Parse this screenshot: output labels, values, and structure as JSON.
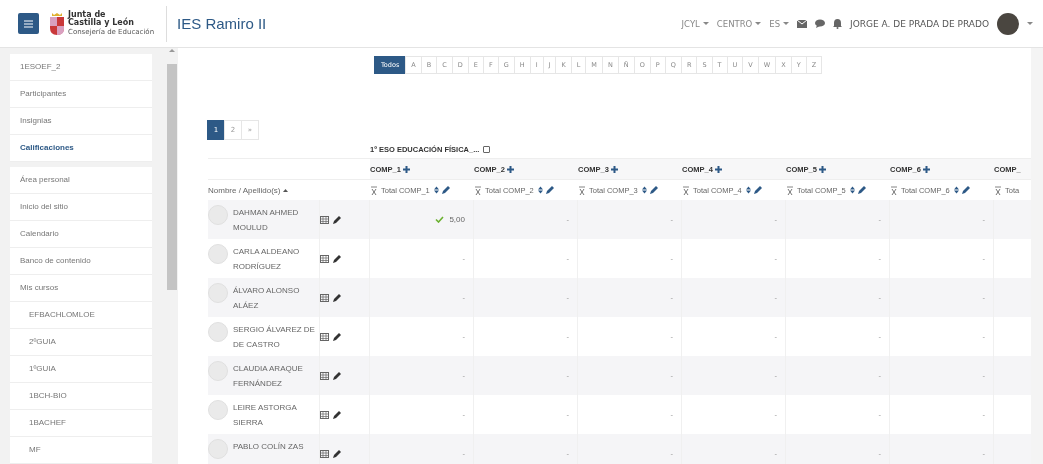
{
  "header": {
    "logo": {
      "lines": [
        "Junta de",
        "Castilla y León",
        "Consejería de Educación"
      ]
    },
    "site_name": "IES Ramiro II",
    "menus": [
      "JCYL",
      "CENTRO",
      "ES"
    ],
    "user_name": "JORGE A. DE PRADA DE PRADO"
  },
  "sidebar": {
    "sections": [
      [
        {
          "label": "1ESOEF_2",
          "selected": false
        },
        {
          "label": "Participantes",
          "selected": false
        },
        {
          "label": "Insignias",
          "selected": false
        },
        {
          "label": "Calificaciones",
          "selected": true
        }
      ],
      [
        {
          "label": "Área personal",
          "selected": false
        },
        {
          "label": "Inicio del sitio",
          "selected": false
        },
        {
          "label": "Calendario",
          "selected": false
        },
        {
          "label": "Banco de contenido",
          "selected": false
        },
        {
          "label": "Mis cursos",
          "selected": false,
          "children": [
            {
              "label": "EFBACHLOMLOE",
              "selected": false
            },
            {
              "label": "2ºGUIA",
              "selected": false
            },
            {
              "label": "1ºGUIA",
              "selected": false
            },
            {
              "label": "1BCH-BIO",
              "selected": false
            },
            {
              "label": "1BACHEF",
              "selected": false
            },
            {
              "label": "MF",
              "selected": false
            }
          ]
        }
      ]
    ]
  },
  "alphabet": [
    {
      "label": "Todos",
      "selected": true
    },
    {
      "label": "A",
      "selected": false
    },
    {
      "label": "B",
      "selected": false
    },
    {
      "label": "C",
      "selected": false
    },
    {
      "label": "D",
      "selected": false
    },
    {
      "label": "E",
      "selected": false
    },
    {
      "label": "F",
      "selected": false
    },
    {
      "label": "G",
      "selected": false
    },
    {
      "label": "H",
      "selected": false
    },
    {
      "label": "I",
      "selected": false
    },
    {
      "label": "J",
      "selected": false
    },
    {
      "label": "K",
      "selected": false
    },
    {
      "label": "L",
      "selected": false
    },
    {
      "label": "M",
      "selected": false
    },
    {
      "label": "N",
      "selected": false
    },
    {
      "label": "Ñ",
      "selected": false
    },
    {
      "label": "O",
      "selected": false
    },
    {
      "label": "P",
      "selected": false
    },
    {
      "label": "Q",
      "selected": false
    },
    {
      "label": "R",
      "selected": false
    },
    {
      "label": "S",
      "selected": false
    },
    {
      "label": "T",
      "selected": false
    },
    {
      "label": "U",
      "selected": false
    },
    {
      "label": "V",
      "selected": false
    },
    {
      "label": "W",
      "selected": false
    },
    {
      "label": "X",
      "selected": false
    },
    {
      "label": "Y",
      "selected": false
    },
    {
      "label": "Z",
      "selected": false
    }
  ],
  "pagination": [
    {
      "label": "1",
      "selected": true
    },
    {
      "label": "2",
      "selected": false
    },
    {
      "label": "»",
      "selected": false
    }
  ],
  "grades": {
    "category": {
      "title": "1º ESO EDUCACIÓN FÍSICA_...",
      "checked": false
    },
    "name_header": "Nombre / Apellido(s)",
    "columns": [
      {
        "kind": "full",
        "title": "COMP_1",
        "total": "Total COMP_1"
      },
      {
        "kind": "full",
        "title": "COMP_2",
        "total": "Total COMP_2"
      },
      {
        "kind": "full",
        "title": "COMP_3",
        "total": "Total COMP_3"
      },
      {
        "kind": "full",
        "title": "COMP_4",
        "total": "Total COMP_4"
      },
      {
        "kind": "full",
        "title": "COMP_5",
        "total": "Total COMP_5"
      },
      {
        "kind": "full",
        "title": "COMP_6",
        "total": "Total COMP_6"
      },
      {
        "kind": "cut",
        "title": "COMP_",
        "total": "Tota"
      }
    ],
    "rows": [
      {
        "name": "DAHMAN AHMED MOULUD",
        "grades": [
          {
            "value": "5,00",
            "checked": true
          },
          {
            "value": "-",
            "checked": false
          },
          {
            "value": "-",
            "checked": false
          },
          {
            "value": "-",
            "checked": false
          },
          {
            "value": "-",
            "checked": false
          },
          {
            "value": "-",
            "checked": false
          }
        ]
      },
      {
        "name": "CARLA ALDEANO RODRÍGUEZ",
        "grades": [
          {
            "value": "-",
            "checked": false
          },
          {
            "value": "-",
            "checked": false
          },
          {
            "value": "-",
            "checked": false
          },
          {
            "value": "-",
            "checked": false
          },
          {
            "value": "-",
            "checked": false
          },
          {
            "value": "-",
            "checked": false
          }
        ]
      },
      {
        "name": "ÁLVARO ALONSO ALÁEZ",
        "grades": [
          {
            "value": "-",
            "checked": false
          },
          {
            "value": "-",
            "checked": false
          },
          {
            "value": "-",
            "checked": false
          },
          {
            "value": "-",
            "checked": false
          },
          {
            "value": "-",
            "checked": false
          },
          {
            "value": "-",
            "checked": false
          }
        ]
      },
      {
        "name": "SERGIO ÁLVAREZ DE DE CASTRO",
        "grades": [
          {
            "value": "-",
            "checked": false
          },
          {
            "value": "-",
            "checked": false
          },
          {
            "value": "-",
            "checked": false
          },
          {
            "value": "-",
            "checked": false
          },
          {
            "value": "-",
            "checked": false
          },
          {
            "value": "-",
            "checked": false
          }
        ]
      },
      {
        "name": "CLAUDIA ARAQUE FERNÁNDEZ",
        "grades": [
          {
            "value": "-",
            "checked": false
          },
          {
            "value": "-",
            "checked": false
          },
          {
            "value": "-",
            "checked": false
          },
          {
            "value": "-",
            "checked": false
          },
          {
            "value": "-",
            "checked": false
          },
          {
            "value": "-",
            "checked": false
          }
        ]
      },
      {
        "name": "LEIRE ASTORGA SIERRA",
        "grades": [
          {
            "value": "-",
            "checked": false
          },
          {
            "value": "-",
            "checked": false
          },
          {
            "value": "-",
            "checked": false
          },
          {
            "value": "-",
            "checked": false
          },
          {
            "value": "-",
            "checked": false
          },
          {
            "value": "-",
            "checked": false
          }
        ]
      },
      {
        "name": "PABLO COLÍN ZAS",
        "grades": [
          {
            "value": "-",
            "checked": false
          },
          {
            "value": "-",
            "checked": false
          },
          {
            "value": "-",
            "checked": false
          },
          {
            "value": "-",
            "checked": false
          },
          {
            "value": "-",
            "checked": false
          },
          {
            "value": "-",
            "checked": false
          }
        ]
      }
    ]
  }
}
